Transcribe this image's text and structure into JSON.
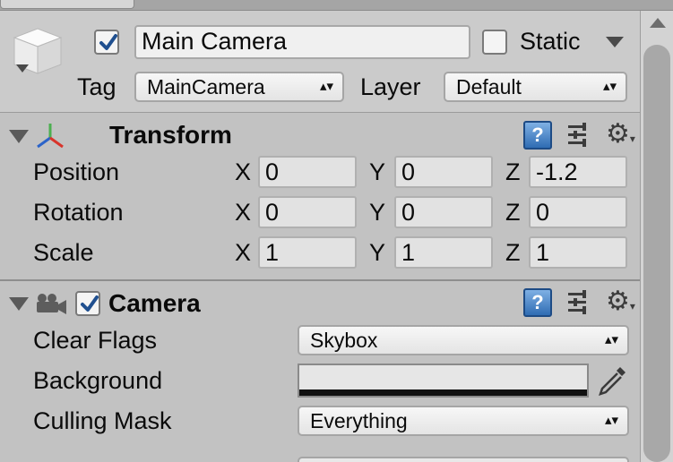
{
  "colors": {
    "panel": "#c2c2c2",
    "header": "#cbcbcb",
    "checkbox_blue": "#1f4f8f",
    "help_blue": "#2f6cb3"
  },
  "header": {
    "object_icon": "cube-icon",
    "active_checked": true,
    "name_value": "Main Camera",
    "static_label": "Static",
    "static_checked": false,
    "tag_label": "Tag",
    "tag_value": "MainCamera",
    "layer_label": "Layer",
    "layer_value": "Default"
  },
  "transform": {
    "title": "Transform",
    "icon": "transform-axes-icon",
    "rows": [
      {
        "label": "Position",
        "x": "0",
        "y": "0",
        "z": "-1.2"
      },
      {
        "label": "Rotation",
        "x": "0",
        "y": "0",
        "z": "0"
      },
      {
        "label": "Scale",
        "x": "1",
        "y": "1",
        "z": "1"
      }
    ],
    "axis_x": "X",
    "axis_y": "Y",
    "axis_z": "Z"
  },
  "camera": {
    "title": "Camera",
    "icon": "camera-icon",
    "enabled": true,
    "clear_flags_label": "Clear Flags",
    "clear_flags_value": "Skybox",
    "background_label": "Background",
    "background_color": "#111111",
    "culling_mask_label": "Culling Mask",
    "culling_mask_value": "Everything"
  },
  "icons": {
    "help": "help-book-icon",
    "presets": "preset-sliders-icon",
    "settings": "gear-icon",
    "foldout": "foldout-arrow-icon",
    "dropdown": "dropdown-arrow-icon",
    "picker": "eyedropper-icon"
  }
}
